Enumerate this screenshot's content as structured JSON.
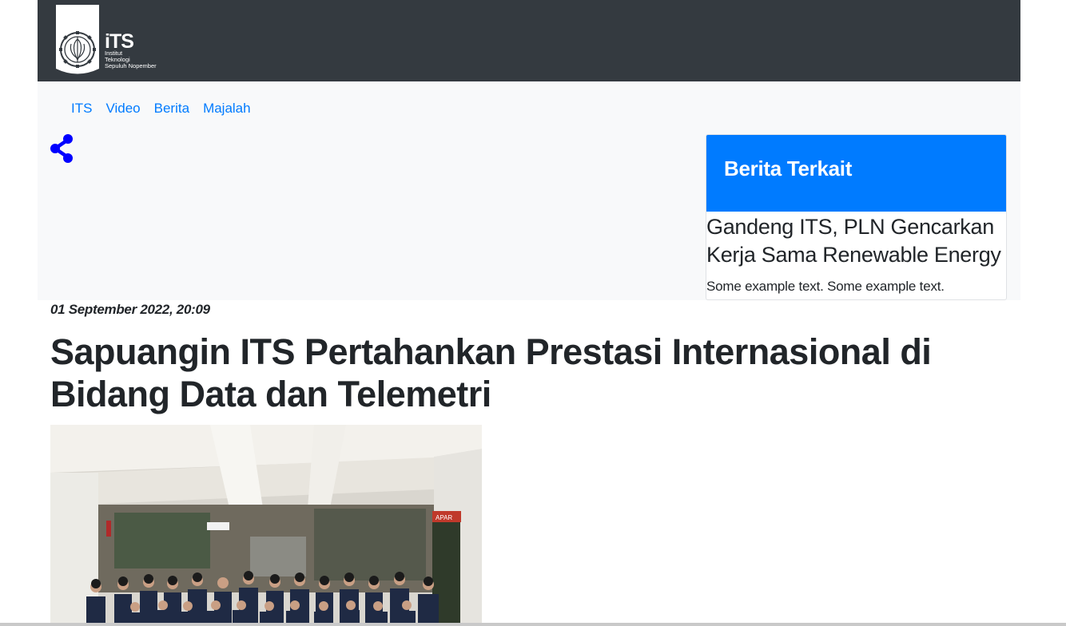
{
  "header": {
    "logo": {
      "brand": "iTS",
      "line1": "Institut",
      "line2": "Teknologi",
      "line3": "Sepuluh Nopember",
      "icon": "its-emblem-icon"
    }
  },
  "nav": {
    "items": [
      {
        "label": "ITS"
      },
      {
        "label": "Video"
      },
      {
        "label": "Berita"
      },
      {
        "label": "Majalah"
      }
    ]
  },
  "share": {
    "icon": "share-icon"
  },
  "related": {
    "header": "Berita Terkait",
    "title": "Gandeng ITS, PLN Gencarkan Kerja Sama Renewable Energy",
    "text": "Some example text. Some example text."
  },
  "article": {
    "date": "01 September 2022, 20:09",
    "title": "Sapuangin ITS Pertahankan Prestasi Internasional di Bidang Data dan Telemetri",
    "photo": {
      "signs": [
        "APAR"
      ]
    }
  },
  "colors": {
    "topbar": "#343a40",
    "light": "#f8f9fa",
    "accent": "#007bff",
    "share": "#0000ff",
    "text": "#212529"
  }
}
